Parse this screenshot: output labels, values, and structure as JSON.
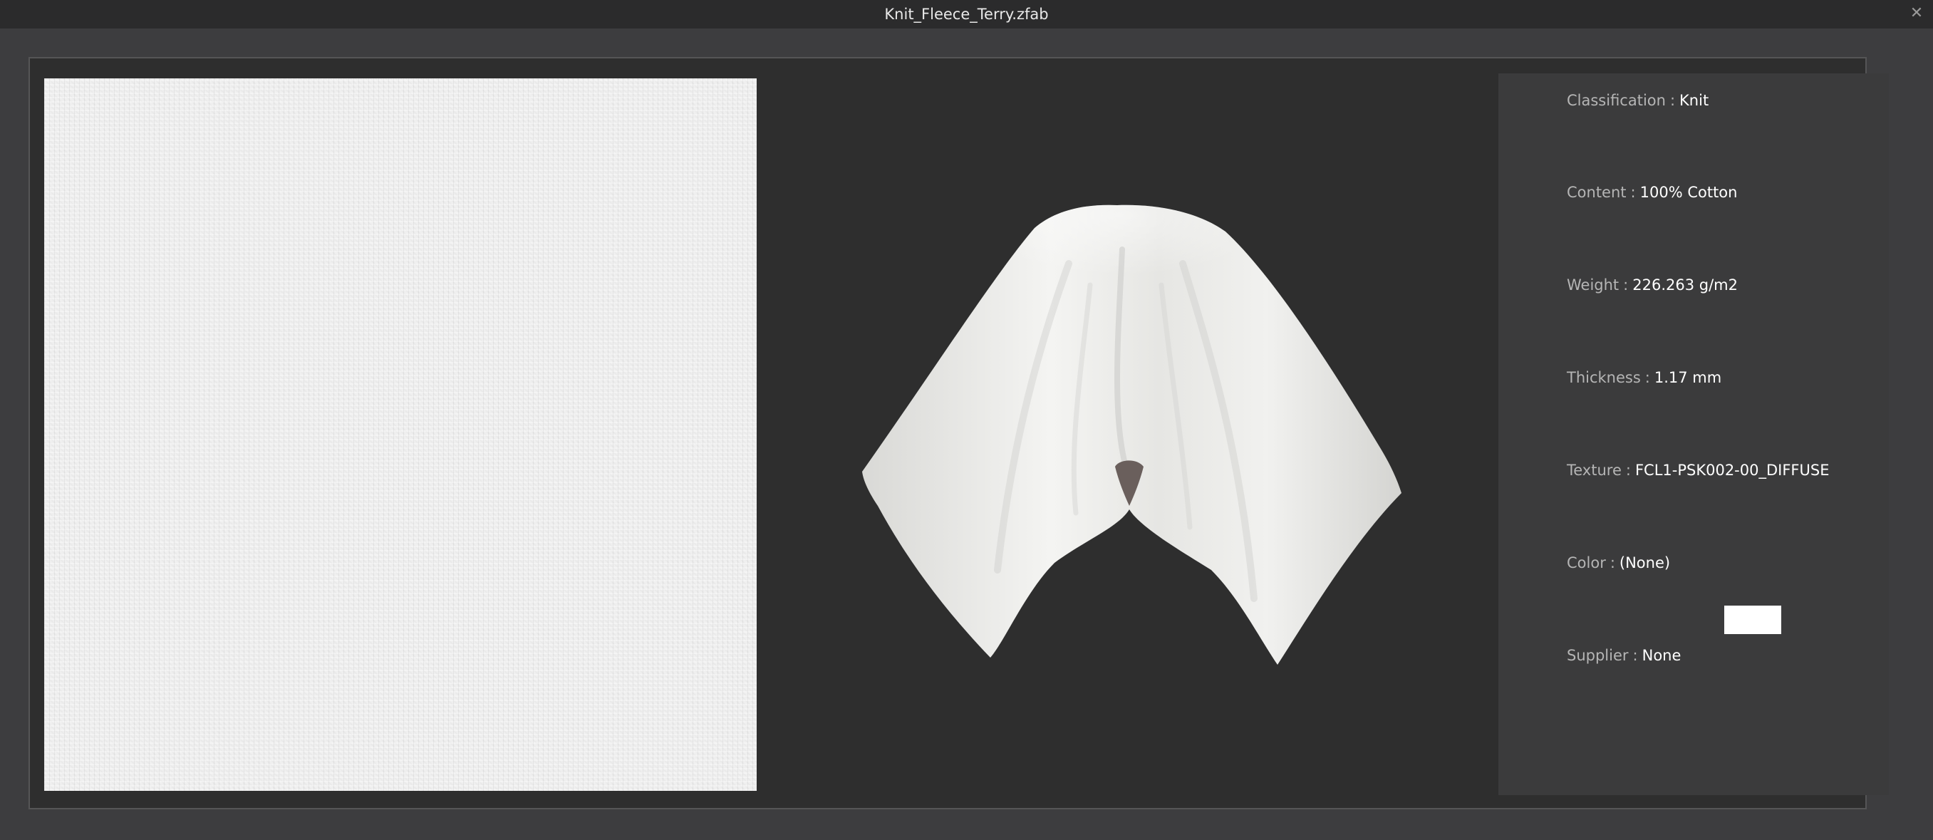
{
  "window": {
    "title": "Knit_Fleece_Terry.zfab",
    "close_glyph": "✕"
  },
  "icons": {
    "close": "close-icon"
  },
  "properties": {
    "classification": {
      "label": "Classification",
      "separator": ":",
      "value": "Knit"
    },
    "content": {
      "label": "Content",
      "separator": ":",
      "value": "100% Cotton"
    },
    "weight": {
      "label": "Weight",
      "separator": ":",
      "value": "226.263 g/m2"
    },
    "thickness": {
      "label": "Thickness",
      "separator": ":",
      "value": "1.17 mm"
    },
    "texture": {
      "label": "Texture",
      "separator": ":",
      "value": "FCL1-PSK002-00_DIFFUSE"
    },
    "color": {
      "label": "Color",
      "separator": ":",
      "value": "(None)",
      "swatch_color": "#ffffff"
    },
    "supplier": {
      "label": "Supplier",
      "separator": ":",
      "value": "None"
    }
  },
  "colors": {
    "background": "#3d3d3f",
    "titlebar": "#2b2b2c",
    "frame": "#2e2e2e",
    "info_panel": "#3b3b3c",
    "fabric": "#efefef"
  }
}
